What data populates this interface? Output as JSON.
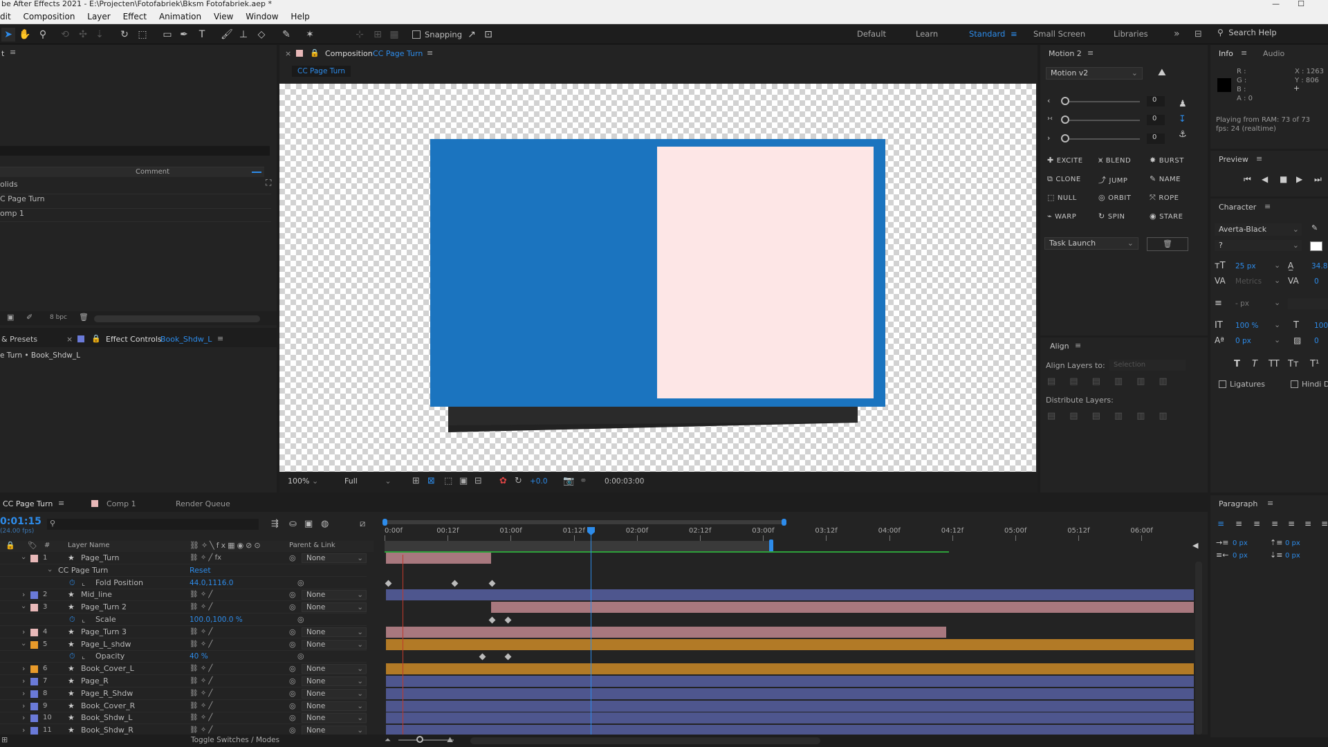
{
  "window": {
    "title": "be After Effects 2021 - E:\\Projecten\\Fotofabriek\\Bksm Fotofabriek.aep *",
    "controls": [
      "—",
      "☐"
    ]
  },
  "menu": [
    "dit",
    "Composition",
    "Layer",
    "Effect",
    "Animation",
    "View",
    "Window",
    "Help"
  ],
  "toolbar": {
    "snapping_label": "Snapping",
    "workspaces": [
      "Default",
      "Learn",
      "Standard",
      "Small Screen",
      "Libraries"
    ],
    "active_workspace": "Standard",
    "search_placeholder": "Search Help"
  },
  "project": {
    "comment_header": "Comment",
    "items": [
      "olids",
      "C Page Turn",
      "omp 1"
    ],
    "bpc": "8 bpc"
  },
  "effect_controls": {
    "tab_presets": "& Presets",
    "tab_label": "Effect Controls",
    "tab_layer": "Book_Shdw_L",
    "breadcrumb": "e Turn • Book_Shdw_L"
  },
  "composition": {
    "tab_label": "Composition",
    "tab_name": "CC Page Turn",
    "subtab": "CC Page Turn",
    "zoom": "100%",
    "resolution": "Full",
    "exposure": "+0.0",
    "timecode": "0:00:03:00"
  },
  "motion": {
    "tab": "Motion 2",
    "preset": "Motion v2",
    "slider_values": [
      "0",
      "0",
      "0"
    ],
    "buttons": [
      {
        "label": "EXCITE",
        "icon": "plus-icon"
      },
      {
        "label": "BLEND",
        "icon": "blend-icon"
      },
      {
        "label": "BURST",
        "icon": "burst-icon"
      },
      {
        "label": "CLONE",
        "icon": "clone-icon"
      },
      {
        "label": "JUMP",
        "icon": "jump-icon"
      },
      {
        "label": "NAME",
        "icon": "pen-icon"
      },
      {
        "label": "NULL",
        "icon": "null-icon"
      },
      {
        "label": "ORBIT",
        "icon": "orbit-icon"
      },
      {
        "label": "ROPE",
        "icon": "rope-icon"
      },
      {
        "label": "WARP",
        "icon": "warp-icon"
      },
      {
        "label": "SPIN",
        "icon": "spin-icon"
      },
      {
        "label": "STARE",
        "icon": "stare-icon"
      }
    ],
    "task": "Task Launch"
  },
  "align": {
    "tab": "Align",
    "align_to_label": "Align Layers to:",
    "align_to_value": "Selection",
    "distribute_label": "Distribute Layers:"
  },
  "info": {
    "tab": "Info",
    "tab2": "Audio",
    "r": "R :",
    "g": "G :",
    "b": "B :",
    "a": "A : 0",
    "x": "X : 1263",
    "y": "Y : 806",
    "playing_line1": "Playing from RAM: 73 of 73",
    "playing_line2": "fps: 24 (realtime)"
  },
  "preview": {
    "tab": "Preview"
  },
  "character": {
    "tab": "Character",
    "font": "Averta-Black",
    "style": "?",
    "size": "25 px",
    "leading": "34.8",
    "kerning": "Metrics",
    "tracking": "0",
    "stroke": "- px",
    "vscale": "100 %",
    "hscale": "100",
    "baseline": "0 px",
    "tsume": "0",
    "style_buttons": [
      "T",
      "T",
      "TT",
      "Tт",
      "T¹"
    ],
    "ligatures": "Ligatures",
    "hindi": "Hindi D"
  },
  "paragraph": {
    "tab": "Paragraph",
    "indent_left": "0 px",
    "indent_right": "0 px",
    "space_before": "0 px",
    "space_after": "0 px",
    "first_indent": "0 px"
  },
  "timeline": {
    "tabs": [
      "CC Page Turn",
      "Comp 1",
      "Render Queue"
    ],
    "current_time": "0:01:15",
    "fps": "(24.00 fps)",
    "col_layer_name": "Layer Name",
    "col_parent": "Parent & Link",
    "ruler": [
      "0:00f",
      "00:12f",
      "01:00f",
      "01:12f",
      "02:00f",
      "02:12f",
      "03:00f",
      "03:12f",
      "04:00f",
      "04:12f",
      "05:00f",
      "05:12f",
      "06:00f"
    ],
    "toggle": "Toggle Switches / Modes",
    "rows": [
      {
        "num": "1",
        "name": "Page_Turn",
        "parent": "None",
        "color": "#e8b8b8",
        "kind": "layer"
      },
      {
        "num": "",
        "name": "CC Page Turn",
        "value": "Reset",
        "kind": "effect"
      },
      {
        "num": "",
        "name": "Fold Position",
        "value": "44.0,1116.0",
        "kind": "prop"
      },
      {
        "num": "2",
        "name": "Mid_line",
        "parent": "None",
        "color": "#6a7ad8",
        "kind": "layer"
      },
      {
        "num": "3",
        "name": "Page_Turn 2",
        "parent": "None",
        "color": "#e8b8b8",
        "kind": "layer"
      },
      {
        "num": "",
        "name": "Scale",
        "value": "100.0,100.0 %",
        "kind": "prop"
      },
      {
        "num": "4",
        "name": "Page_Turn 3",
        "parent": "None",
        "color": "#e8b8b8",
        "kind": "layer"
      },
      {
        "num": "5",
        "name": "Page_L_shdw",
        "parent": "None",
        "color": "#e89a2a",
        "kind": "layer"
      },
      {
        "num": "",
        "name": "Opacity",
        "value": "40 %",
        "kind": "prop"
      },
      {
        "num": "6",
        "name": "Book_Cover_L",
        "parent": "None",
        "color": "#e89a2a",
        "kind": "layer"
      },
      {
        "num": "7",
        "name": "Page_R",
        "parent": "None",
        "color": "#6a7ad8",
        "kind": "layer"
      },
      {
        "num": "8",
        "name": "Page_R_Shdw",
        "parent": "None",
        "color": "#6a7ad8",
        "kind": "layer"
      },
      {
        "num": "9",
        "name": "Book_Cover_R",
        "parent": "None",
        "color": "#6a7ad8",
        "kind": "layer"
      },
      {
        "num": "10",
        "name": "Book_Shdw_L",
        "parent": "None",
        "color": "#6a7ad8",
        "kind": "layer"
      },
      {
        "num": "11",
        "name": "Book_Shdw_R",
        "parent": "None",
        "color": "#6a7ad8",
        "kind": "layer"
      }
    ]
  },
  "colors": {
    "accent": "#2d8ceb",
    "book_blue": "#1b74bf",
    "page_pink": "#fde6e6",
    "bar_pink": "#a8787e",
    "bar_blue": "#4e568e",
    "bar_orange": "#b27a26",
    "work_area_green": "#2ea13a"
  }
}
